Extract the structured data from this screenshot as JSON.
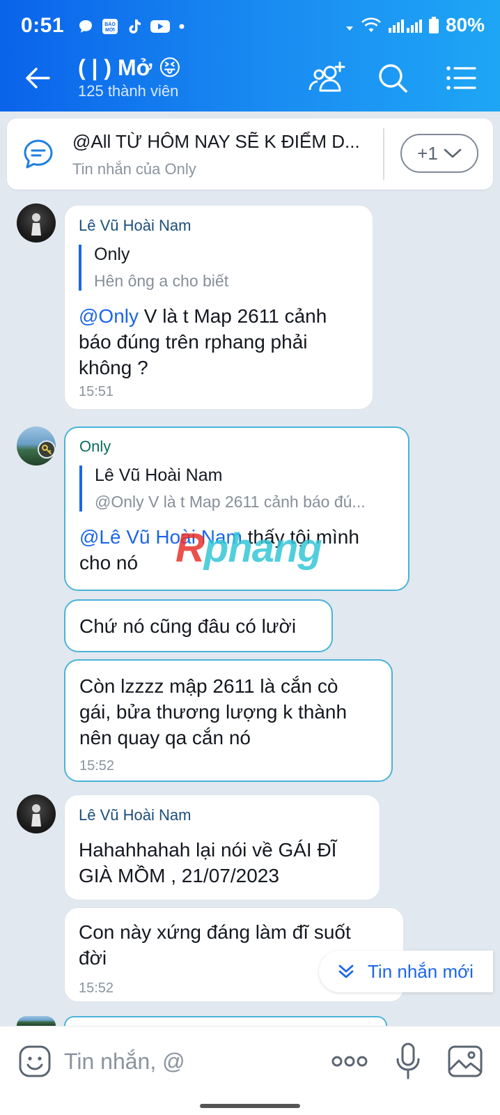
{
  "status_bar": {
    "time": "0:51",
    "battery": "80%",
    "notification_icons": [
      "chat-bubble-icon",
      "bao-moi-icon",
      "tiktok-icon",
      "youtube-icon",
      "dot-icon"
    ]
  },
  "app_bar": {
    "title": "( | ) Mở 😝",
    "subtitle": "125 thành viên"
  },
  "pinned": {
    "title": "@All  TỪ HÔM NAY SẼ K ĐIỂM D...",
    "subtitle": "Tin nhắn của Only",
    "more_label": "+1"
  },
  "messages": [
    {
      "sender": "Lê Vũ Hoài Nam",
      "quote_name": "Only",
      "quote_text": "Hên ông a cho biết",
      "mention": "@Only",
      "text_line1": " V là t Map 2611 cảnh",
      "text_line2": "báo đúng trên rphang phải",
      "text_line3": "không ?",
      "time": "15:51"
    },
    {
      "sender": "Only",
      "quote_name": "Lê Vũ Hoài Nam",
      "quote_text": "@Only V là t Map 2611 cảnh báo đú...",
      "mention": "@Lê Vũ Hoài Nam",
      "text_line1": " thấy tội mình",
      "text_line2": "cho nó"
    },
    {
      "text_line1": "Chứ nó cũng đâu có lười"
    },
    {
      "text_line1": "Còn lzzzz mập 2611 là cắn cò",
      "text_line2": "gái, bửa thương lượng k thành",
      "text_line3": "nên quay qa cắn nó",
      "time": "15:52"
    },
    {
      "sender": "Lê Vũ Hoài Nam",
      "text_line1": "Hahahhahah lại nói về GÁI ĐĨ",
      "text_line2": "GIÀ MỒM , 21/07/2023"
    },
    {
      "text_line1": "Con này xứng đáng làm đĩ suốt",
      "text_line2": "đời",
      "time": "15:52"
    }
  ],
  "watermark": {
    "first": "R",
    "rest": "phang"
  },
  "new_messages_label": "Tin nhắn mới",
  "input": {
    "placeholder": "Tin nhắn, @"
  },
  "colors": {
    "header_start": "#0a63ea",
    "header_end": "#1ea6f5",
    "mention": "#1b66e8",
    "own_bubble_border": "#49b3d7",
    "background": "#e2e8ef"
  }
}
